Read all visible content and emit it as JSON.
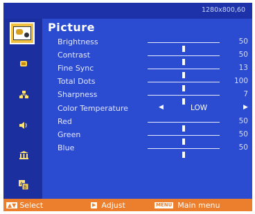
{
  "header": {
    "resolution": "1280x800,60"
  },
  "sidebar": {
    "items": [
      {
        "icon": "picture-icon"
      },
      {
        "icon": "display-icon"
      },
      {
        "icon": "network-icon"
      },
      {
        "icon": "audio-icon"
      },
      {
        "icon": "setup-icon"
      },
      {
        "icon": "language-icon"
      }
    ]
  },
  "menu": {
    "title": "Picture",
    "items": [
      {
        "label": "Brightness",
        "value": "50",
        "level": 0.5
      },
      {
        "label": "Contrast",
        "value": "50",
        "level": 0.5
      },
      {
        "label": "Fine Sync",
        "value": "13",
        "level": 0.5
      },
      {
        "label": "Total Dots",
        "value": "100",
        "level": 0.5
      },
      {
        "label": "Sharpness",
        "value": "7",
        "level": 0.5
      },
      {
        "label": "Color Temperature",
        "value": "LOW",
        "type": "selector"
      },
      {
        "label": "Red",
        "value": "50",
        "level": 0.5
      },
      {
        "label": "Green",
        "value": "50",
        "level": 0.5
      },
      {
        "label": "Blue",
        "value": "50",
        "level": 0.5
      }
    ]
  },
  "footer": {
    "select_label": "Select",
    "adjust_label": "Adjust",
    "menu_key": "MENU",
    "main_menu_label": "Main menu"
  },
  "colors": {
    "panel": "#2b4bd1",
    "sidebar": "#1b2f9e",
    "footer": "#ec7f2e",
    "highlight": "#f0c040"
  }
}
